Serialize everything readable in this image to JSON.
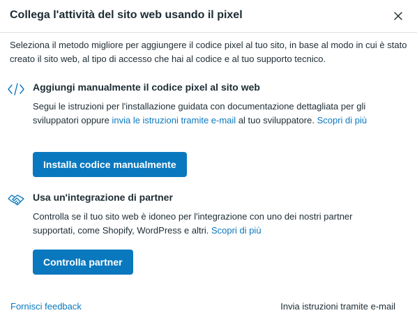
{
  "dialog": {
    "title": "Collega l'attività del sito web usando il pixel",
    "intro": "Seleziona il metodo migliore per aggiungere il codice pixel al tuo sito, in base al modo in cui è stato creato il sito web, al tipo di accesso che hai al codice e al tuo supporto tecnico."
  },
  "manual": {
    "icon": "code-icon",
    "title": "Aggiungi manualmente il codice pixel al sito web",
    "desc_before": "Segui le istruzioni per l'installazione guidata con documentazione dettagliata per gli sviluppatori oppure ",
    "desc_link": "invia le istruzioni tramite e-mail",
    "desc_after": " al tuo sviluppatore. ",
    "learn_more": "Scopri di più",
    "button_label": "Installa codice manualmente"
  },
  "partner": {
    "icon": "handshake-icon",
    "title": "Usa un'integrazione di partner",
    "desc_before": "Controlla se il tuo sito web è idoneo per l'integrazione con uno dei nostri partner supportati, come Shopify, WordPress e altri. ",
    "learn_more": "Scopri di più",
    "button_label": "Controlla partner"
  },
  "footer": {
    "feedback_link": "Fornisci feedback",
    "email_action": "Invia istruzioni tramite e-mail"
  },
  "colors": {
    "accent": "#0a78be",
    "text": "#1c2b33",
    "divider": "#dde1e4"
  }
}
